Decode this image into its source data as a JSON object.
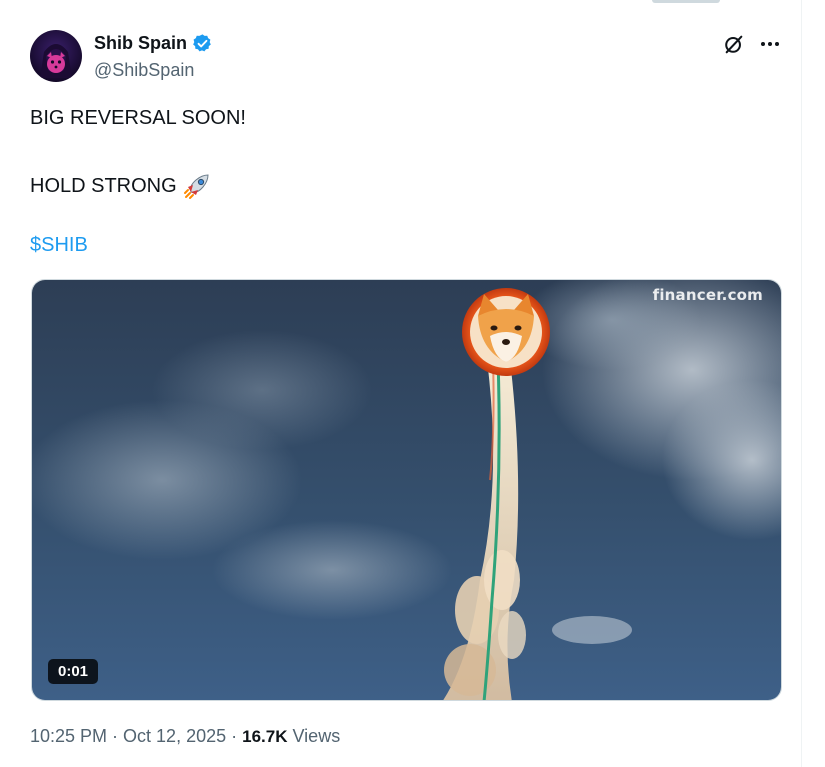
{
  "author": {
    "display_name": "Shib Spain",
    "handle": "@ShibSpain",
    "verified": true,
    "avatar_icon": "masked-shiba-avatar-icon"
  },
  "header_actions": {
    "grok_icon": "grok-icon",
    "more_icon": "more-dots-icon"
  },
  "tweet": {
    "line1": "BIG REVERSAL SOON!",
    "line2": "HOLD STRONG",
    "line2_emoji_icon": "rocket-icon",
    "hashtag": "$SHIB"
  },
  "media": {
    "watermark": "financer.com",
    "duration": "0:01",
    "scene": "shiba-coin-rocket-icon"
  },
  "meta": {
    "time": "10:25 PM",
    "sep1": " · ",
    "date": "Oct 12, 2025",
    "sep2": " · ",
    "views_count": "16.7K",
    "views_label": " Views"
  },
  "colors": {
    "link": "#1d9bf0",
    "verified": "#1d9bf0",
    "secondary_text": "#536471",
    "primary_text": "#0f1419"
  }
}
